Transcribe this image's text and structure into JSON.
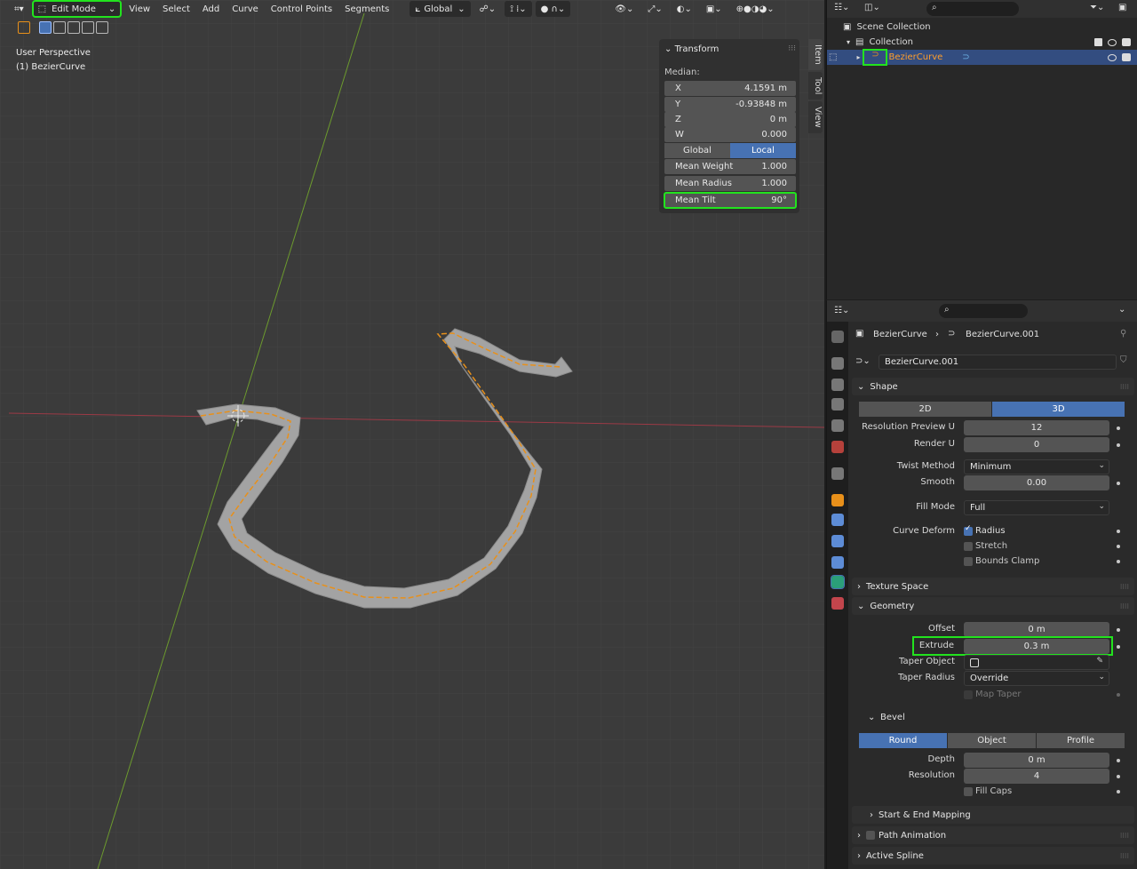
{
  "viewport": {
    "mode": "Edit Mode",
    "menus": [
      "View",
      "Select",
      "Add",
      "Curve",
      "Control Points",
      "Segments"
    ],
    "orientation": "Global",
    "info_line1": "User Perspective",
    "info_line2": "(1) BezierCurve"
  },
  "npanel": {
    "title": "Transform",
    "median_label": "Median:",
    "fields": [
      {
        "label": "X",
        "value": "4.1591 m"
      },
      {
        "label": "Y",
        "value": "-0.93848 m"
      },
      {
        "label": "Z",
        "value": "0 m"
      },
      {
        "label": "W",
        "value": "0.000"
      }
    ],
    "space_toggle": [
      "Global",
      "Local"
    ],
    "extra_fields": [
      {
        "label": "Mean Weight",
        "value": "1.000"
      },
      {
        "label": "Mean Radius",
        "value": "1.000"
      },
      {
        "label": "Mean Tilt",
        "value": "90°"
      }
    ],
    "tabs": [
      "Item",
      "Tool",
      "View"
    ]
  },
  "outliner": {
    "scene_collection": "Scene Collection",
    "collection": "Collection",
    "object": "BezierCurve"
  },
  "properties": {
    "breadcrumb_object": "BezierCurve",
    "breadcrumb_data": "BezierCurve.001",
    "datablock_name": "BezierCurve.001",
    "shape": {
      "title": "Shape",
      "dim_toggle": [
        "2D",
        "3D"
      ],
      "resolution_preview_u_label": "Resolution Preview U",
      "resolution_preview_u": "12",
      "render_u_label": "Render U",
      "render_u": "0",
      "twist_method_label": "Twist Method",
      "twist_method": "Minimum",
      "smooth_label": "Smooth",
      "smooth": "0.00",
      "fill_mode_label": "Fill Mode",
      "fill_mode": "Full",
      "curve_deform_label": "Curve Deform",
      "radius_label": "Radius",
      "stretch_label": "Stretch",
      "bounds_clamp_label": "Bounds Clamp"
    },
    "texture_space_title": "Texture Space",
    "geometry": {
      "title": "Geometry",
      "offset_label": "Offset",
      "offset": "0 m",
      "extrude_label": "Extrude",
      "extrude": "0.3 m",
      "taper_object_label": "Taper Object",
      "taper_radius_label": "Taper Radius",
      "taper_radius": "Override",
      "map_taper_label": "Map Taper"
    },
    "bevel": {
      "title": "Bevel",
      "type_toggle": [
        "Round",
        "Object",
        "Profile"
      ],
      "depth_label": "Depth",
      "depth": "0 m",
      "resolution_label": "Resolution",
      "resolution": "4",
      "fill_caps_label": "Fill Caps"
    },
    "start_end_mapping_title": "Start & End Mapping",
    "path_animation_title": "Path Animation",
    "active_spline_title": "Active Spline"
  },
  "colors": {
    "highlight": "#22e31e",
    "accent_blue": "#4772b3",
    "curve_orange": "#e8901a",
    "curve_body": "#a3a3a3"
  }
}
